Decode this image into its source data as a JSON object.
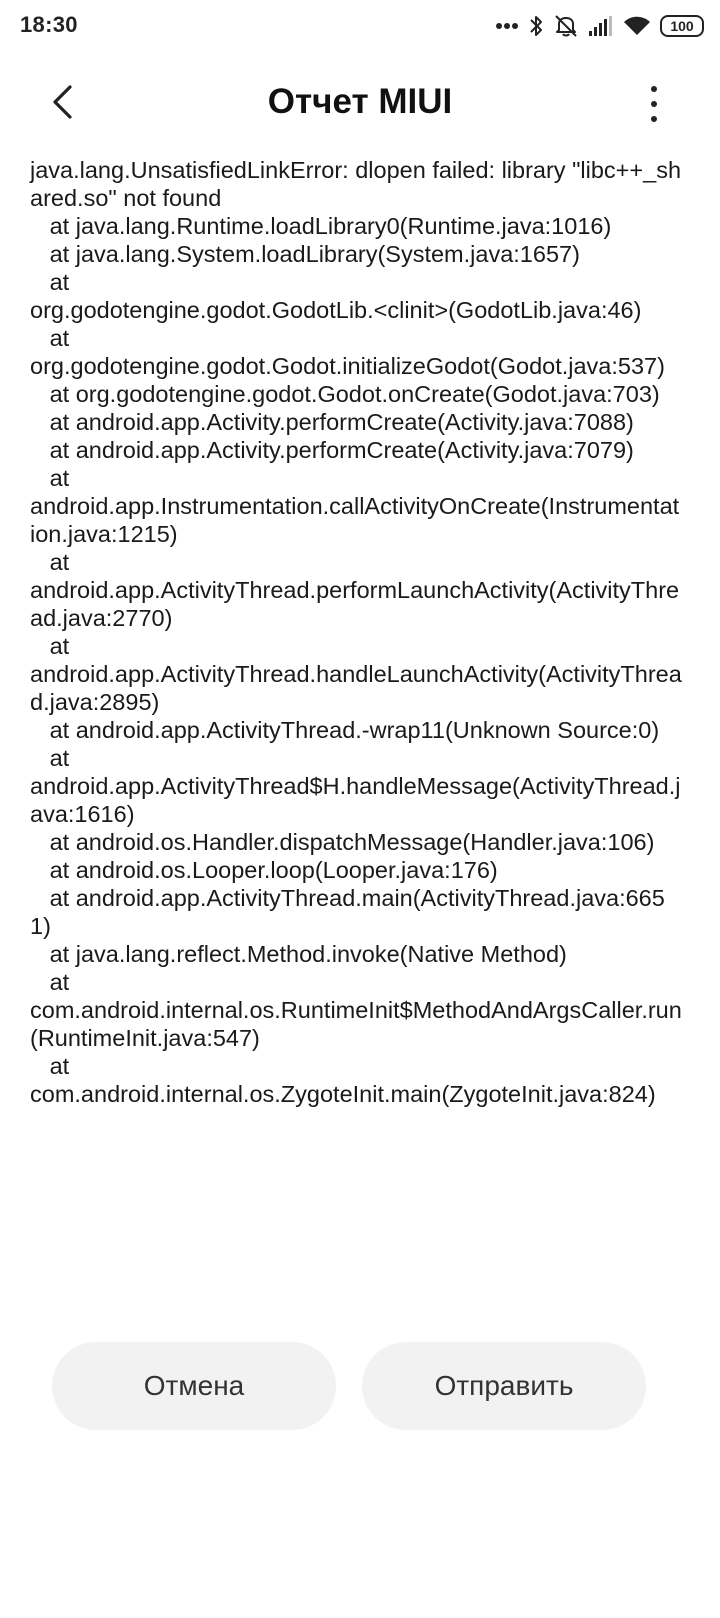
{
  "status_bar": {
    "time": "18:30",
    "battery": "100",
    "icons": [
      "more-dots-icon",
      "bluetooth-icon",
      "vibrate-off-icon",
      "signal-icon",
      "wifi-icon",
      "battery-icon"
    ]
  },
  "header": {
    "title": "Отчет MIUI",
    "back_icon": "chevron-left-icon",
    "menu_icon": "more-vertical-icon"
  },
  "report": {
    "text": "java.lang.UnsatisfiedLinkError: dlopen failed: library \"libc++_shared.so\" not found\n   at java.lang.Runtime.loadLibrary0(Runtime.java:1016)\n   at java.lang.System.loadLibrary(System.java:1657)\n   at\norg.godotengine.godot.GodotLib.<clinit>(GodotLib.java:46)\n   at\norg.godotengine.godot.Godot.initializeGodot(Godot.java:537)\n   at org.godotengine.godot.Godot.onCreate(Godot.java:703)\n   at android.app.Activity.performCreate(Activity.java:7088)\n   at android.app.Activity.performCreate(Activity.java:7079)\n   at\nandroid.app.Instrumentation.callActivityOnCreate(Instrumentation.java:1215)\n   at\nandroid.app.ActivityThread.performLaunchActivity(ActivityThread.java:2770)\n   at\nandroid.app.ActivityThread.handleLaunchActivity(ActivityThread.java:2895)\n   at android.app.ActivityThread.-wrap11(Unknown Source:0)\n   at\nandroid.app.ActivityThread$H.handleMessage(ActivityThread.java:1616)\n   at android.os.Handler.dispatchMessage(Handler.java:106)\n   at android.os.Looper.loop(Looper.java:176)\n   at android.app.ActivityThread.main(ActivityThread.java:6651)\n   at java.lang.reflect.Method.invoke(Native Method)\n   at\ncom.android.internal.os.RuntimeInit$MethodAndArgsCaller.run(RuntimeInit.java:547)\n   at\ncom.android.internal.os.ZygoteInit.main(ZygoteInit.java:824)"
  },
  "actions": {
    "cancel_label": "Отмена",
    "send_label": "Отправить"
  },
  "colors": {
    "background": "#ffffff",
    "button_bg": "#f2f2f2",
    "text": "#1a1a1a"
  }
}
